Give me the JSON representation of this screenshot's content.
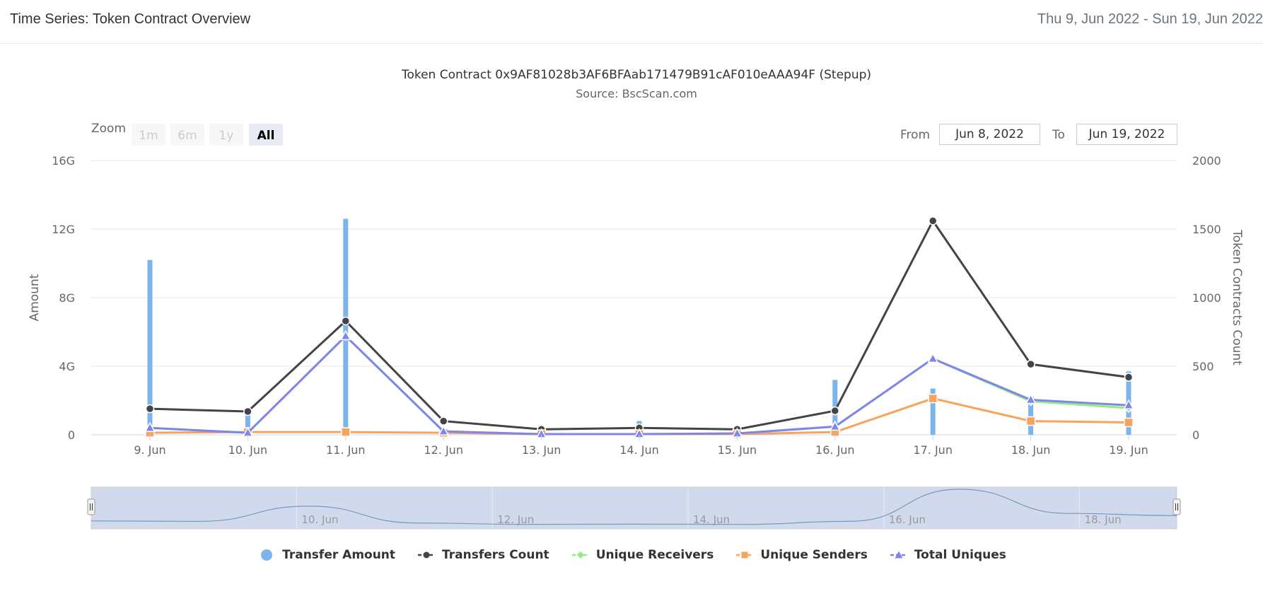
{
  "header": {
    "title": "Time Series: Token Contract Overview",
    "date_range": "Thu 9, Jun 2022 - Sun 19, Jun 2022"
  },
  "range_selector": {
    "zoom_label": "Zoom",
    "buttons": [
      "1m",
      "6m",
      "1y",
      "All"
    ],
    "selected": "All",
    "from_label": "From",
    "from_value": "Jun 8, 2022",
    "to_label": "To",
    "to_value": "Jun 19, 2022"
  },
  "navigator": {
    "labels": [
      "10. Jun",
      "12. Jun",
      "14. Jun",
      "16. Jun",
      "18. Jun"
    ]
  },
  "chart_data": {
    "type": "line",
    "title": "Token Contract 0x9AF81028b3AF6BFAab171479B91cAF010eAAA94F (Stepup)",
    "subtitle": "Source: BscScan.com",
    "categories": [
      "9. Jun",
      "10. Jun",
      "11. Jun",
      "12. Jun",
      "13. Jun",
      "14. Jun",
      "15. Jun",
      "16. Jun",
      "17. Jun",
      "18. Jun",
      "19. Jun"
    ],
    "y_left": {
      "label": "Amount",
      "ticks": [
        "0",
        "4G",
        "8G",
        "12G",
        "16G"
      ],
      "range": [
        0,
        16
      ]
    },
    "y_right": {
      "label": "Token Contracts Count",
      "ticks": [
        "0",
        "500",
        "1000",
        "1500",
        "2000"
      ],
      "range": [
        0,
        2000
      ]
    },
    "grid": true,
    "legend_position": "bottom-center",
    "series": [
      {
        "name": "Transfer Amount",
        "type": "column",
        "axis": "left",
        "color": "#7cb5ec",
        "bars": [
          {
            "x": 9.0,
            "y": 10.2
          },
          {
            "x": 10.0,
            "y": 1.2
          },
          {
            "x": 11.0,
            "y": 12.6
          },
          {
            "x": 14.0,
            "y": 0.8
          },
          {
            "x": 16.0,
            "y": 3.2
          },
          {
            "x": 17.0,
            "y": 2.7
          },
          {
            "x": 18.0,
            "y": 2.2
          },
          {
            "x": 19.0,
            "y": 3.7
          }
        ]
      },
      {
        "name": "Transfers Count",
        "type": "line",
        "axis": "right",
        "color": "#434348",
        "marker": "circle",
        "values": [
          190,
          170,
          830,
          100,
          40,
          50,
          40,
          175,
          1560,
          515,
          420
        ]
      },
      {
        "name": "Unique Receivers",
        "type": "line",
        "axis": "right",
        "color": "#90ed7d",
        "marker": "diamond",
        "values": [
          50,
          15,
          720,
          25,
          5,
          5,
          10,
          60,
          555,
          245,
          195
        ]
      },
      {
        "name": "Unique Senders",
        "type": "line",
        "axis": "right",
        "color": "#f7a35c",
        "marker": "square",
        "values": [
          15,
          20,
          20,
          15,
          5,
          5,
          5,
          20,
          265,
          100,
          90
        ]
      },
      {
        "name": "Total Uniques",
        "type": "line",
        "axis": "right",
        "color": "#8085e9",
        "marker": "triangle",
        "values": [
          50,
          15,
          720,
          25,
          5,
          5,
          10,
          60,
          555,
          255,
          215
        ]
      }
    ]
  }
}
